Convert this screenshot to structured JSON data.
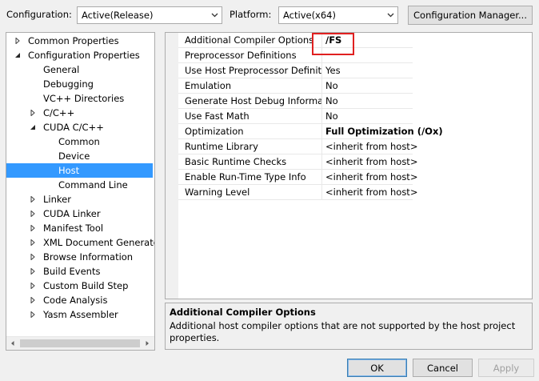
{
  "config": {
    "configuration_label": "Configuration:",
    "configuration_value": "Active(Release)",
    "platform_label": "Platform:",
    "platform_value": "Active(x64)",
    "manager_button": "Configuration Manager..."
  },
  "tree": [
    {
      "label": "Common Properties",
      "expander": "collapsed",
      "indent": 0
    },
    {
      "label": "Configuration Properties",
      "expander": "expanded",
      "indent": 0
    },
    {
      "label": "General",
      "expander": "none",
      "indent": 1
    },
    {
      "label": "Debugging",
      "expander": "none",
      "indent": 1
    },
    {
      "label": "VC++ Directories",
      "expander": "none",
      "indent": 1
    },
    {
      "label": "C/C++",
      "expander": "collapsed",
      "indent": 1
    },
    {
      "label": "CUDA C/C++",
      "expander": "expanded",
      "indent": 1
    },
    {
      "label": "Common",
      "expander": "none",
      "indent": 2
    },
    {
      "label": "Device",
      "expander": "none",
      "indent": 2
    },
    {
      "label": "Host",
      "expander": "none",
      "indent": 2,
      "selected": true
    },
    {
      "label": "Command Line",
      "expander": "none",
      "indent": 2
    },
    {
      "label": "Linker",
      "expander": "collapsed",
      "indent": 1
    },
    {
      "label": "CUDA Linker",
      "expander": "collapsed",
      "indent": 1
    },
    {
      "label": "Manifest Tool",
      "expander": "collapsed",
      "indent": 1
    },
    {
      "label": "XML Document Generator",
      "expander": "collapsed",
      "indent": 1
    },
    {
      "label": "Browse Information",
      "expander": "collapsed",
      "indent": 1
    },
    {
      "label": "Build Events",
      "expander": "collapsed",
      "indent": 1
    },
    {
      "label": "Custom Build Step",
      "expander": "collapsed",
      "indent": 1
    },
    {
      "label": "Code Analysis",
      "expander": "collapsed",
      "indent": 1
    },
    {
      "label": "Yasm Assembler",
      "expander": "collapsed",
      "indent": 1
    }
  ],
  "properties": [
    {
      "name": "Additional Compiler Options",
      "value": "/FS",
      "bold": true
    },
    {
      "name": "Preprocessor Definitions",
      "value": "",
      "bold": false
    },
    {
      "name": "Use Host Preprocessor Definitions",
      "value": "Yes",
      "bold": false
    },
    {
      "name": "Emulation",
      "value": "No",
      "bold": false
    },
    {
      "name": "Generate Host Debug Information",
      "value": "No",
      "bold": false
    },
    {
      "name": "Use Fast Math",
      "value": "No",
      "bold": false
    },
    {
      "name": "Optimization",
      "value": "Full Optimization (/Ox)",
      "bold": true
    },
    {
      "name": "Runtime Library",
      "value": "<inherit from host>",
      "bold": false
    },
    {
      "name": "Basic Runtime Checks",
      "value": "<inherit from host>",
      "bold": false
    },
    {
      "name": "Enable Run-Time Type Info",
      "value": "<inherit from host>",
      "bold": false
    },
    {
      "name": "Warning Level",
      "value": "<inherit from host>",
      "bold": false
    }
  ],
  "description": {
    "title": "Additional Compiler Options",
    "body": "Additional host compiler options that are not supported by the host project properties."
  },
  "buttons": {
    "ok": "OK",
    "cancel": "Cancel",
    "apply": "Apply"
  },
  "colors": {
    "selection": "#3399ff",
    "highlight_box": "#e02020"
  }
}
